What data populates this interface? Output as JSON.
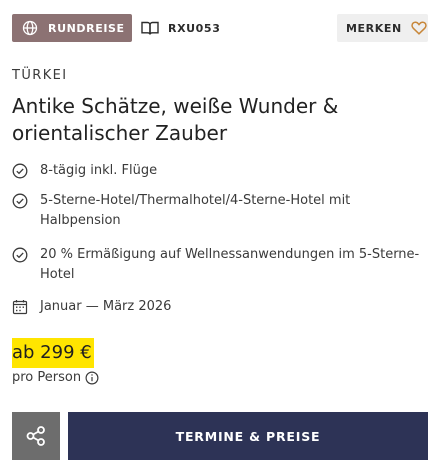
{
  "header": {
    "type_badge": "RUNDREISE",
    "trip_code": "RXU053",
    "merken_label": "MERKEN"
  },
  "offer": {
    "country": "TÜRKEI",
    "title": "Antike Schätze, weiße Wunder & orientalischer Zauber",
    "features": [
      "8-tägig inkl. Flüge",
      "5-Sterne-Hotel/Thermalhotel/4-Sterne-Hotel mit Halbpension",
      "20 % Ermäßigung auf Wellnessanwendungen im 5-Sterne-Hotel"
    ],
    "dates": "Januar — März 2026",
    "price": "ab 299 €",
    "price_note": "pro Person"
  },
  "actions": {
    "cta_label": "TERMINE & PREISE"
  },
  "colors": {
    "badge": "#8c7273",
    "price_highlight": "#ffe500",
    "cta": "#2d3356",
    "share": "#6d6d6d",
    "heart": "#c8873a"
  }
}
